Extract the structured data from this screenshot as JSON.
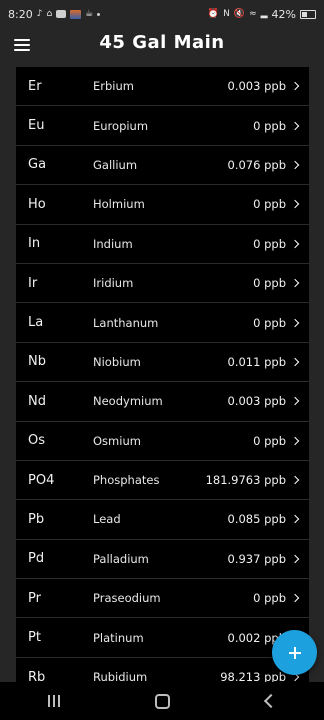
{
  "status": {
    "time": "8:20",
    "battery": "42%"
  },
  "app": {
    "title": "45 Gal Main"
  },
  "rows": [
    {
      "symbol": "Er",
      "name": "Erbium",
      "value": "0.003 ppb"
    },
    {
      "symbol": "Eu",
      "name": "Europium",
      "value": "0 ppb"
    },
    {
      "symbol": "Ga",
      "name": "Gallium",
      "value": "0.076 ppb"
    },
    {
      "symbol": "Ho",
      "name": "Holmium",
      "value": "0 ppb"
    },
    {
      "symbol": "In",
      "name": "Indium",
      "value": "0 ppb"
    },
    {
      "symbol": "Ir",
      "name": "Iridium",
      "value": "0 ppb"
    },
    {
      "symbol": "La",
      "name": "Lanthanum",
      "value": "0 ppb"
    },
    {
      "symbol": "Nb",
      "name": "Niobium",
      "value": "0.011 ppb"
    },
    {
      "symbol": "Nd",
      "name": "Neodymium",
      "value": "0.003 ppb"
    },
    {
      "symbol": "Os",
      "name": "Osmium",
      "value": "0 ppb"
    },
    {
      "symbol": "PO4",
      "name": "Phosphates",
      "value": "181.9763 ppb"
    },
    {
      "symbol": "Pb",
      "name": "Lead",
      "value": "0.085 ppb"
    },
    {
      "symbol": "Pd",
      "name": "Palladium",
      "value": "0.937 ppb"
    },
    {
      "symbol": "Pr",
      "name": "Praseodium",
      "value": "0 ppb"
    },
    {
      "symbol": "Pt",
      "name": "Platinum",
      "value": "0.002 ppb"
    },
    {
      "symbol": "Rb",
      "name": "Rubidium",
      "value": "98.213 ppb"
    }
  ],
  "colors": {
    "accent": "#1da1de",
    "background": "#262626",
    "list_background": "#000000"
  },
  "icons": {
    "menu": "hamburger-icon",
    "fab": "plus-icon",
    "row_action": "chevron-right-icon"
  }
}
